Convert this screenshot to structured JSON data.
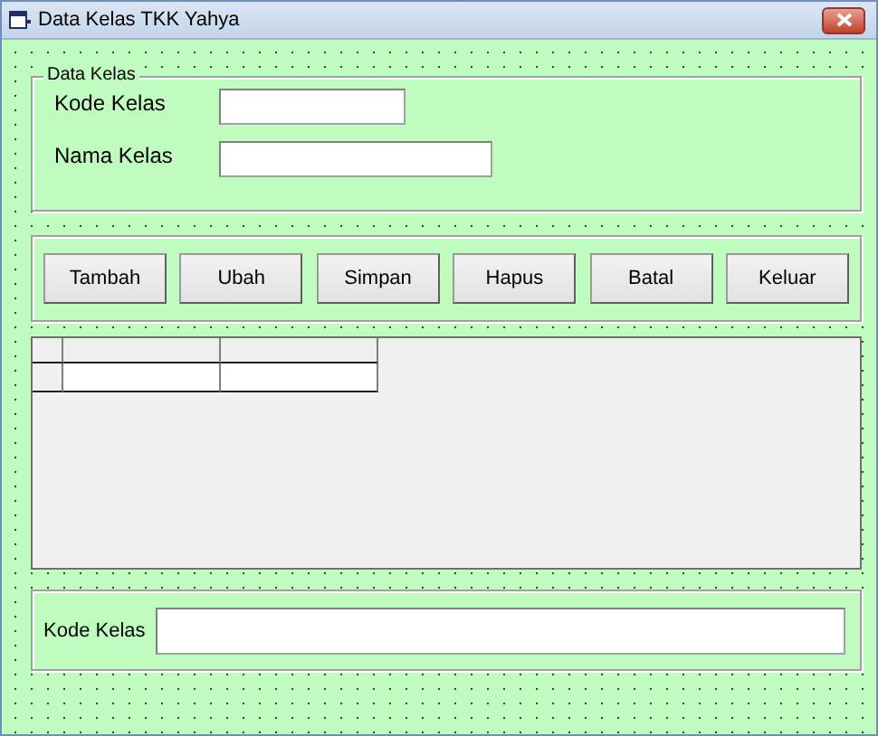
{
  "window": {
    "title": "Data Kelas TKK Yahya"
  },
  "data_frame": {
    "caption": "Data Kelas",
    "fields": [
      {
        "label": "Kode Kelas"
      },
      {
        "label": "Nama Kelas"
      }
    ]
  },
  "buttons": [
    "Tambah",
    "Ubah",
    "Simpan",
    "Hapus",
    "Batal",
    "Keluar"
  ],
  "search": {
    "label": "Kode Kelas"
  }
}
